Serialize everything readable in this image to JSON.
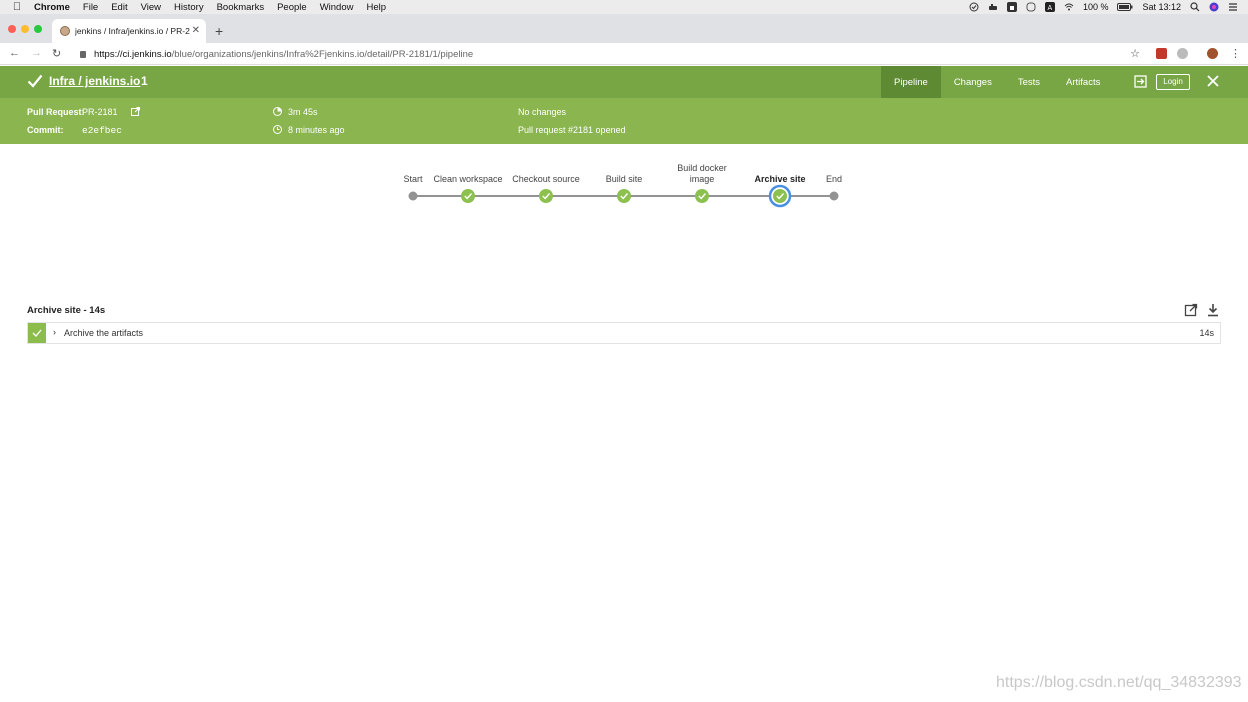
{
  "menubar": {
    "app": "Chrome",
    "items": [
      "File",
      "Edit",
      "View",
      "History",
      "Bookmarks",
      "People",
      "Window",
      "Help"
    ],
    "battery": "100 %",
    "clock": "Sat 13:12"
  },
  "browser": {
    "tab_title": "jenkins / Infra/jenkins.io / PR-2",
    "url_host": "https://ci.jenkins.io",
    "url_path": "/blue/organizations/jenkins/Infra%2Fjenkins.io/detail/PR-2181/1/pipeline"
  },
  "run": {
    "title": "Infra / jenkins.io",
    "number": "1",
    "nav": [
      "Pipeline",
      "Changes",
      "Tests",
      "Artifacts"
    ],
    "active_nav": "Pipeline",
    "login_label": "Login",
    "status_color": "#78a645"
  },
  "details": {
    "pr_label": "Pull Request:",
    "pr_value": "PR-2181",
    "commit_label": "Commit:",
    "commit_value": "e2efbec",
    "duration": "3m 45s",
    "ago": "8 minutes ago",
    "changes": "No changes",
    "cause": "Pull request #2181 opened"
  },
  "pipeline": {
    "stages": [
      {
        "label": "Start",
        "kind": "endpoint"
      },
      {
        "label": "Clean workspace",
        "kind": "success"
      },
      {
        "label": "Checkout source",
        "kind": "success"
      },
      {
        "label": "Build site",
        "kind": "success"
      },
      {
        "label": "Build docker image",
        "kind": "success"
      },
      {
        "label": "Archive site",
        "kind": "selected"
      },
      {
        "label": "End",
        "kind": "endpoint"
      }
    ]
  },
  "steps": {
    "title": "Archive site - 14s",
    "rows": [
      {
        "name": "Archive the artifacts",
        "duration": "14s"
      }
    ]
  },
  "watermark": "https://blog.csdn.net/qq_34832393"
}
